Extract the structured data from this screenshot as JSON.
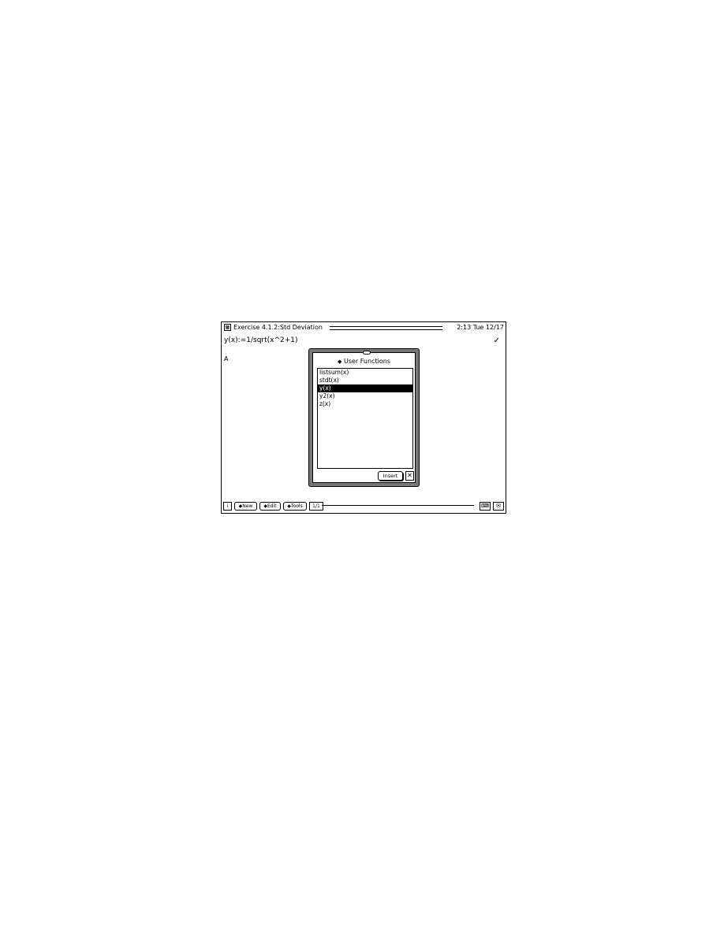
{
  "window": {
    "title": "Exercise 4.1.2:Std Deviation",
    "clock": "2:13 Tue 12/17",
    "app_icon": "calc-icon"
  },
  "notebook": {
    "formula": "y(x):=1/sqrt(x^2+1)",
    "check": "✓",
    "cursor": "A"
  },
  "dialog": {
    "title_marker": "◆",
    "title": "User Functions",
    "items": [
      {
        "label": "listsum(x)",
        "selected": false
      },
      {
        "label": "stdt(x)",
        "selected": false
      },
      {
        "label": "y(x)",
        "selected": true
      },
      {
        "label": "y2(x)",
        "selected": false
      },
      {
        "label": "z(x)",
        "selected": false
      }
    ],
    "insert_label": "Insert",
    "close_label": "✕"
  },
  "bottombar": {
    "info_label": "i",
    "new_label": "New",
    "edit_label": "Edit",
    "tools_label": "Tools",
    "page_label": "1/1",
    "left_icon": "keyboard-icon",
    "right_icon": "envelope-icon"
  }
}
